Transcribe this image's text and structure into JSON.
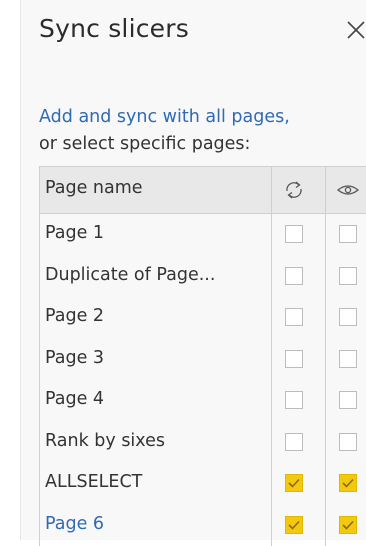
{
  "pane": {
    "title": "Sync slicers",
    "close_icon": "close-icon",
    "description_line1": "Add and sync with all pages,",
    "description_line2": "or select specific pages:"
  },
  "table": {
    "header": {
      "page_name": "Page name",
      "sync_icon": "sync-icon",
      "visible_icon": "eye-icon"
    },
    "rows": [
      {
        "name": "Page 1",
        "sync": false,
        "visible": false
      },
      {
        "name": "Duplicate of Page...",
        "sync": false,
        "visible": false
      },
      {
        "name": "Page 2",
        "sync": false,
        "visible": false
      },
      {
        "name": "Page 3",
        "sync": false,
        "visible": false
      },
      {
        "name": "Page 4",
        "sync": false,
        "visible": false
      },
      {
        "name": "Rank by sixes",
        "sync": false,
        "visible": false
      },
      {
        "name": "ALLSELECT",
        "sync": true,
        "visible": true
      },
      {
        "name": "Page 6",
        "sync": true,
        "visible": true
      }
    ]
  },
  "colors": {
    "accent": "#f2c811",
    "link": "#2f6ab3"
  }
}
